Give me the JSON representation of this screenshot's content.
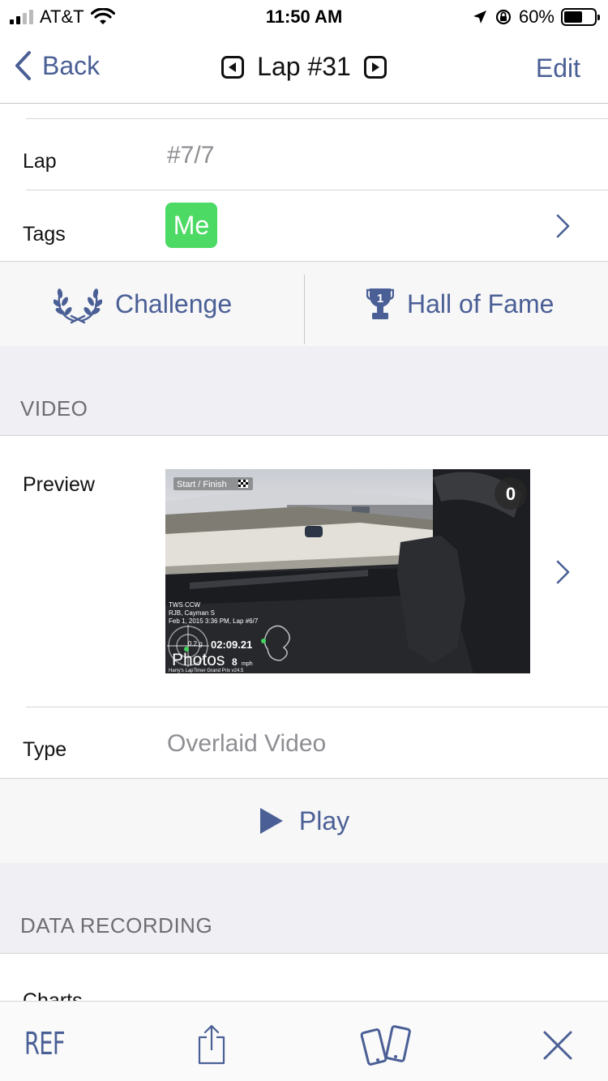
{
  "status": {
    "carrier": "AT&T",
    "time": "11:50 AM",
    "battery": "60%",
    "battery_level": 0.6
  },
  "nav": {
    "back_label": "Back",
    "title": "Lap #31",
    "edit_label": "Edit"
  },
  "lap": {
    "label": "Lap",
    "value": "#7/7"
  },
  "tags": {
    "label": "Tags",
    "items": [
      "Me"
    ]
  },
  "actions": {
    "challenge_label": "Challenge",
    "hall_of_fame_label": "Hall of Fame",
    "trophy_number": "1"
  },
  "video": {
    "header": "VIDEO",
    "preview_label": "Preview",
    "type_label": "Type",
    "type_value": "Overlaid Video",
    "play_label": "Play",
    "thumb": {
      "marker": "Start / Finish",
      "badge": "0",
      "info_line1": "TWS CCW",
      "info_line2": "RJB, Cayman S",
      "info_line3": "Feb 1, 2015 3:36 PM, Lap #6/7",
      "gforce": "0.2 g",
      "laptime": "02:09.21",
      "speed_unit": "mph",
      "overlay_label": "Photos",
      "speed_suffix": "8",
      "footer": "Harry's LapTimer Grand Prix v24.5"
    }
  },
  "data_recording": {
    "header": "DATA RECORDING",
    "charts_label": "Charts"
  },
  "tabbar": {
    "ref_label": "REF"
  },
  "colors": {
    "accent": "#4a5f95",
    "tag_green": "#4cd964",
    "secondary_text": "#8e8e93",
    "section_bg": "#efeff4"
  }
}
